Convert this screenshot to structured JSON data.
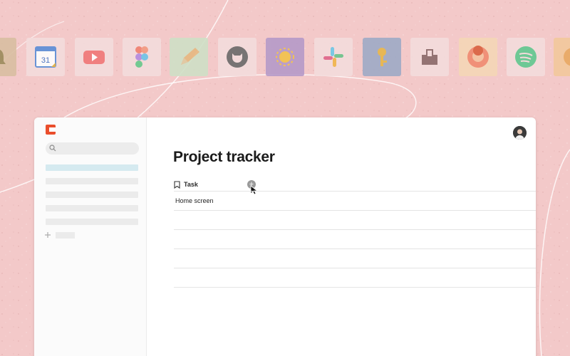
{
  "icons": [
    {
      "name": "bell-icon",
      "bg": "#d9bfa2"
    },
    {
      "name": "google-calendar-icon",
      "bg": "#f4dcdc"
    },
    {
      "name": "youtube-icon",
      "bg": "#f4dcdc"
    },
    {
      "name": "figma-icon",
      "bg": "#f4dcdc"
    },
    {
      "name": "pencil-app-icon",
      "bg": "#cfe0c6"
    },
    {
      "name": "github-icon",
      "bg": "#f4dcdc"
    },
    {
      "name": "sun-app-icon",
      "bg": "#b59ac8"
    },
    {
      "name": "slack-icon",
      "bg": "#f4dcdc"
    },
    {
      "name": "key-app-icon",
      "bg": "#9eabc6"
    },
    {
      "name": "box-app-icon",
      "bg": "#f4dcdc"
    },
    {
      "name": "avatar-app-icon",
      "bg": "#f5d7b7"
    },
    {
      "name": "spotify-icon",
      "bg": "#f4dcdc"
    },
    {
      "name": "partial-app-icon",
      "bg": "#f2c89c"
    }
  ],
  "calendar_day": "31",
  "brand_color": "#ea4e2c",
  "page": {
    "title": "Project tracker",
    "column_label": "Task",
    "add_column_symbol": "+",
    "rows": [
      "Home screen"
    ]
  }
}
